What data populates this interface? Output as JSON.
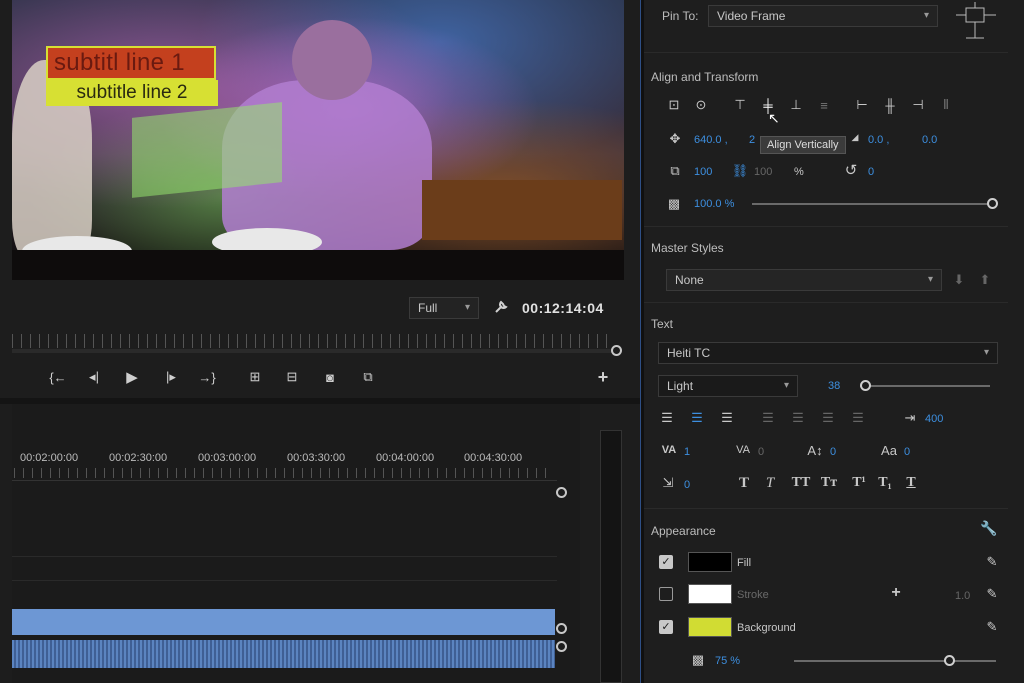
{
  "video": {
    "subtitle_line1": "subtitl line 1",
    "subtitle_line2": "subtitle line 2"
  },
  "monitor": {
    "resolution": "Full",
    "timecode": "00:12:14:04"
  },
  "transport_controls": [
    "add-marker",
    "step-back",
    "play",
    "step-forward",
    "go-to-out",
    "insert",
    "overwrite",
    "export-frame",
    "comparison-view",
    "add"
  ],
  "timeline": {
    "ruler_labels": [
      "00:02:00:00",
      "00:02:30:00",
      "00:03:00:00",
      "00:03:30:00",
      "00:04:00:00",
      "00:04:30:00"
    ]
  },
  "panel": {
    "pin_to_label": "Pin To:",
    "pin_to_value": "Video Frame",
    "align": {
      "title": "Align and Transform",
      "position_x": "640.0 ,",
      "position_y": "2",
      "anchor_x": "0.0 ,",
      "anchor_y": "0.0",
      "scale": "100",
      "scale_linked": "100",
      "percent": "%",
      "rotation": "0",
      "opacity": "100.0 %",
      "tooltip": "Align Vertically"
    },
    "master_styles": {
      "title": "Master Styles",
      "value": "None"
    },
    "text": {
      "title": "Text",
      "font": "Heiti TC",
      "style": "Light",
      "size": "38",
      "size_fraction": 0.0,
      "leading": "400",
      "kerning": "1",
      "tracking": "0",
      "baseline": "0",
      "tsume": "0",
      "tab_width": "0",
      "typographic_labels": [
        "T",
        "T",
        "TT",
        "Tт",
        "T¹",
        "T₁",
        "T"
      ]
    },
    "appearance": {
      "title": "Appearance",
      "fill_label": "Fill",
      "fill_color": "#000000",
      "fill_checked": true,
      "stroke_label": "Stroke",
      "stroke_color": "#ffffff",
      "stroke_checked": false,
      "stroke_width": "1.0",
      "background_label": "Background",
      "background_color": "#d1dc33",
      "background_checked": true,
      "background_opacity": "75 %"
    }
  }
}
